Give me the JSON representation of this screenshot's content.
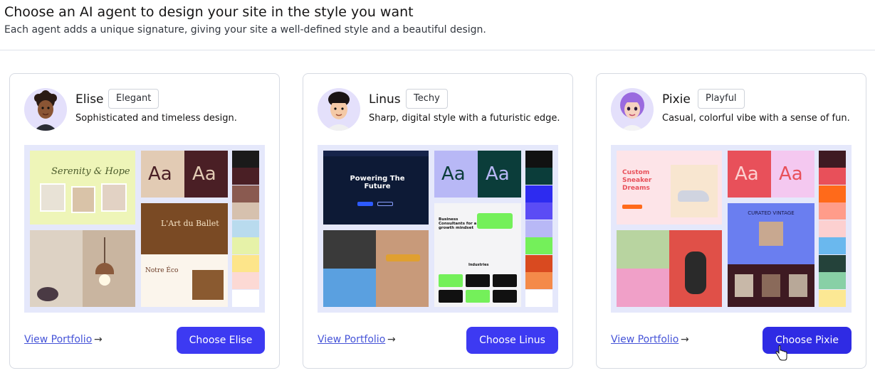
{
  "header": {
    "title": "Choose an AI agent to design your site in the style you want",
    "subtitle": "Each agent adds a unique signature, giving your site a well-defined style and a beautiful design."
  },
  "agents": [
    {
      "name": "Elise",
      "tag": "Elegant",
      "description": "Sophisticated and timeless design.",
      "portfolio_label": "View Portfolio",
      "choose_label": "Choose Elise",
      "palette": [
        "#1a1a1a",
        "#4a1f25",
        "#8a5a50",
        "#d6c1ae",
        "#b9dbee",
        "#e6f2a8",
        "#fde58a",
        "#fcd9d4",
        "#ffffff"
      ],
      "preview_text": {
        "hero": "Serenity & Hope",
        "ballet": "L'Art du Ballet",
        "eco": "Notre Éco",
        "aa": "Aa"
      }
    },
    {
      "name": "Linus",
      "tag": "Techy",
      "description": "Sharp, digital style with a futuristic edge.",
      "portfolio_label": "View Portfolio",
      "choose_label": "Choose Linus",
      "palette": [
        "#111111",
        "#0b3d3a",
        "#2d2bf0",
        "#5b4cf5",
        "#b8b8f6",
        "#74f05a",
        "#d94a20",
        "#f48a4a",
        "#ffffff"
      ],
      "preview_text": {
        "hero": "Powering The Future",
        "consult": "Business Consultants for a growth mindset",
        "industries": "Industries",
        "aa": "Aa"
      }
    },
    {
      "name": "Pixie",
      "tag": "Playful",
      "description": "Casual, colorful vibe with a sense of fun.",
      "portfolio_label": "View Portfolio",
      "choose_label": "Choose Pixie",
      "palette": [
        "#3e1a22",
        "#e8505a",
        "#ff6a1a",
        "#ff9c8a",
        "#fcd0d0",
        "#6ab8ee",
        "#24423a",
        "#88d0a6",
        "#fce894"
      ],
      "preview_text": {
        "hero": "Custom Sneaker Dreams",
        "vintage": "CURATED VINTAGE",
        "aa": "Aa"
      }
    }
  ],
  "colors": {
    "accent": "#3d3af2",
    "link": "#4654d8",
    "border": "#d6dae2"
  },
  "icons": {
    "arrow": "→",
    "cursor": "hand-pointer-icon"
  }
}
